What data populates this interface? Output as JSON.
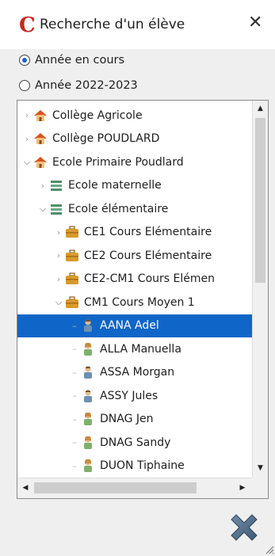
{
  "window": {
    "title": "Recherche d'un élève",
    "logo_letter": "C",
    "close_glyph": "✕"
  },
  "year_options": [
    {
      "label": "Année en cours",
      "checked": true
    },
    {
      "label": "Année 2022-2023",
      "checked": false
    }
  ],
  "tree": {
    "rows": [
      {
        "label": "Collège Agricole",
        "icon": "school-house-icon",
        "depth": 0,
        "state": "collapsed",
        "selected": false
      },
      {
        "label": "Collège POUDLARD",
        "icon": "school-house-icon",
        "depth": 0,
        "state": "collapsed",
        "selected": false
      },
      {
        "label": "Ecole Primaire Poudlard",
        "icon": "school-house-icon",
        "depth": 0,
        "state": "expanded",
        "selected": false
      },
      {
        "label": "Ecole maternelle",
        "icon": "level-stack-icon",
        "depth": 1,
        "state": "collapsed",
        "selected": false
      },
      {
        "label": "Ecole élémentaire",
        "icon": "level-stack-icon",
        "depth": 1,
        "state": "expanded",
        "selected": false
      },
      {
        "label": "CE1  Cours Elémentaire",
        "icon": "class-briefcase-icon",
        "depth": 2,
        "state": "collapsed",
        "selected": false
      },
      {
        "label": "CE2  Cours Elémentaire",
        "icon": "class-briefcase-icon",
        "depth": 2,
        "state": "collapsed",
        "selected": false
      },
      {
        "label": "CE2-CM1  Cours Elémen",
        "icon": "class-briefcase-icon",
        "depth": 2,
        "state": "collapsed",
        "selected": false
      },
      {
        "label": "CM1  Cours Moyen 1",
        "icon": "class-briefcase-icon",
        "depth": 2,
        "state": "expanded",
        "selected": false
      },
      {
        "label": "AANA Adel",
        "icon": "student-boy-icon",
        "depth": 3,
        "state": "leaf",
        "selected": true
      },
      {
        "label": "ALLA Manuella",
        "icon": "student-girl-icon",
        "depth": 3,
        "state": "leaf",
        "selected": false
      },
      {
        "label": "ASSA Morgan",
        "icon": "student-boy-icon",
        "depth": 3,
        "state": "leaf",
        "selected": false
      },
      {
        "label": "ASSY Jules",
        "icon": "student-boy-icon",
        "depth": 3,
        "state": "leaf",
        "selected": false
      },
      {
        "label": "DNAG Jen",
        "icon": "student-girl-icon",
        "depth": 3,
        "state": "leaf",
        "selected": false
      },
      {
        "label": "DNAG Sandy",
        "icon": "student-girl-icon",
        "depth": 3,
        "state": "leaf",
        "selected": false
      },
      {
        "label": "DUON Tiphaine",
        "icon": "student-girl-icon",
        "depth": 3,
        "state": "leaf",
        "selected": false
      }
    ]
  },
  "scrollbars": {
    "up": "▲",
    "down": "▼",
    "left": "◀",
    "right": "▶"
  },
  "actions": {
    "cancel_icon": "cancel-cross-icon"
  },
  "colors": {
    "logo_red": "#c8281e",
    "selection_blue": "#0f66c8",
    "house_roof": "#d9531e",
    "briefcase": "#d89a2b",
    "stack_green": "#4f8f6a"
  }
}
